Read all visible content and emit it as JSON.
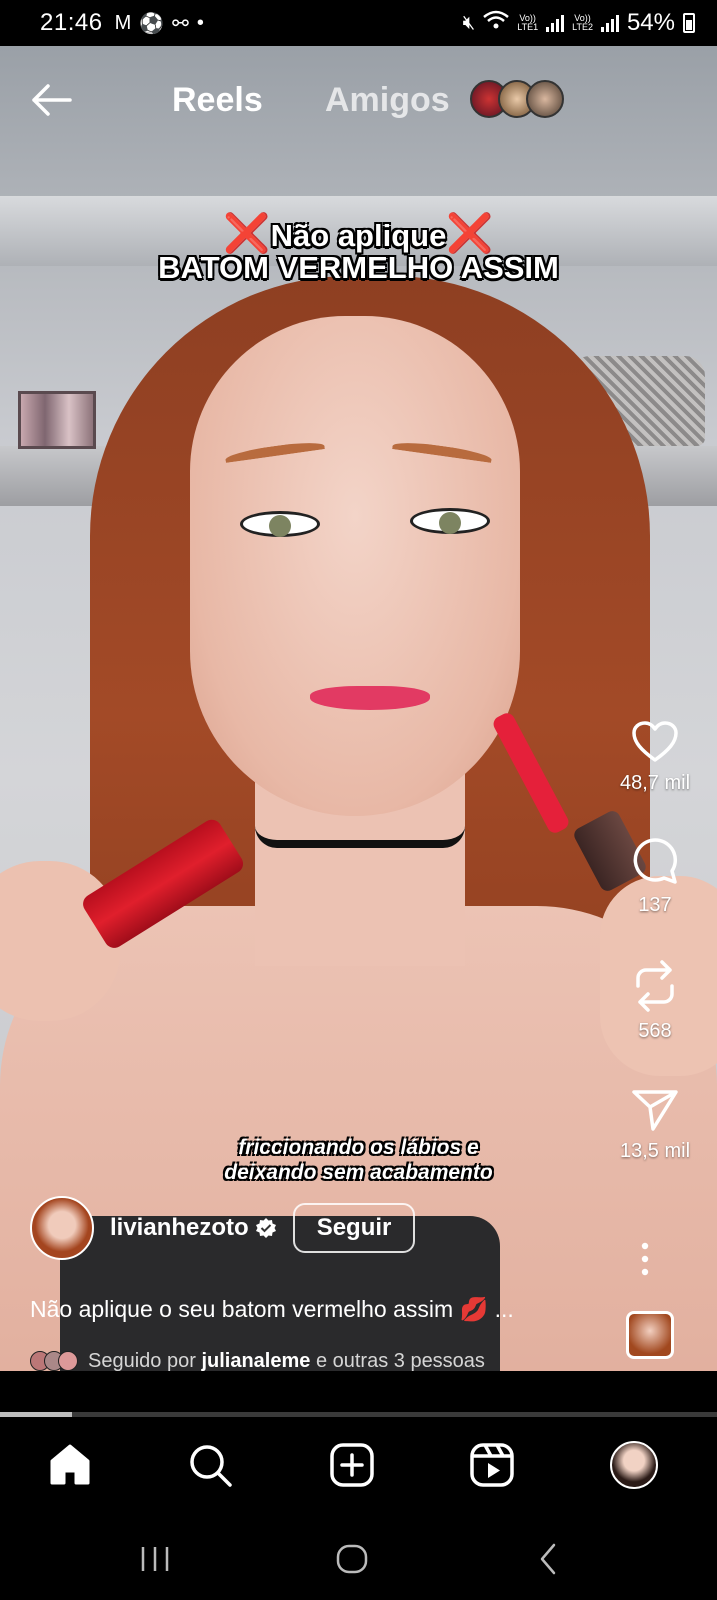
{
  "status_bar": {
    "time": "21:46",
    "battery": "54%",
    "sim1": "LTE1",
    "sim2": "LTE2",
    "volte": "Vo))"
  },
  "top_nav": {
    "tabs": [
      {
        "label": "Reels",
        "active": true
      },
      {
        "label": "Amigos",
        "active": false
      }
    ]
  },
  "video": {
    "headline_line1": "Não aplique",
    "headline_x": "❌",
    "headline_line2": "BATOM VERMELHO ASSIM",
    "subtitle_line1": "friccionando os lábios e",
    "subtitle_line2": "deixando sem acabamento"
  },
  "actions": {
    "likes": "48,7 mil",
    "comments": "137",
    "reposts": "568",
    "shares": "13,5 mil"
  },
  "author": {
    "username": "livianhezoto",
    "follow_label": "Seguir"
  },
  "post": {
    "caption": "Não aplique o seu batom vermelho assim 💋 ...",
    "followed_by_prefix": "Seguido por",
    "followed_by_user": "julianaleme",
    "followed_by_suffix": "e outras 3 pessoas"
  },
  "playback": {
    "progress": 0.1
  },
  "colors": {
    "background": "#000000",
    "headline_x": "#e0141e",
    "progress_fill": "#bdbdbd"
  }
}
